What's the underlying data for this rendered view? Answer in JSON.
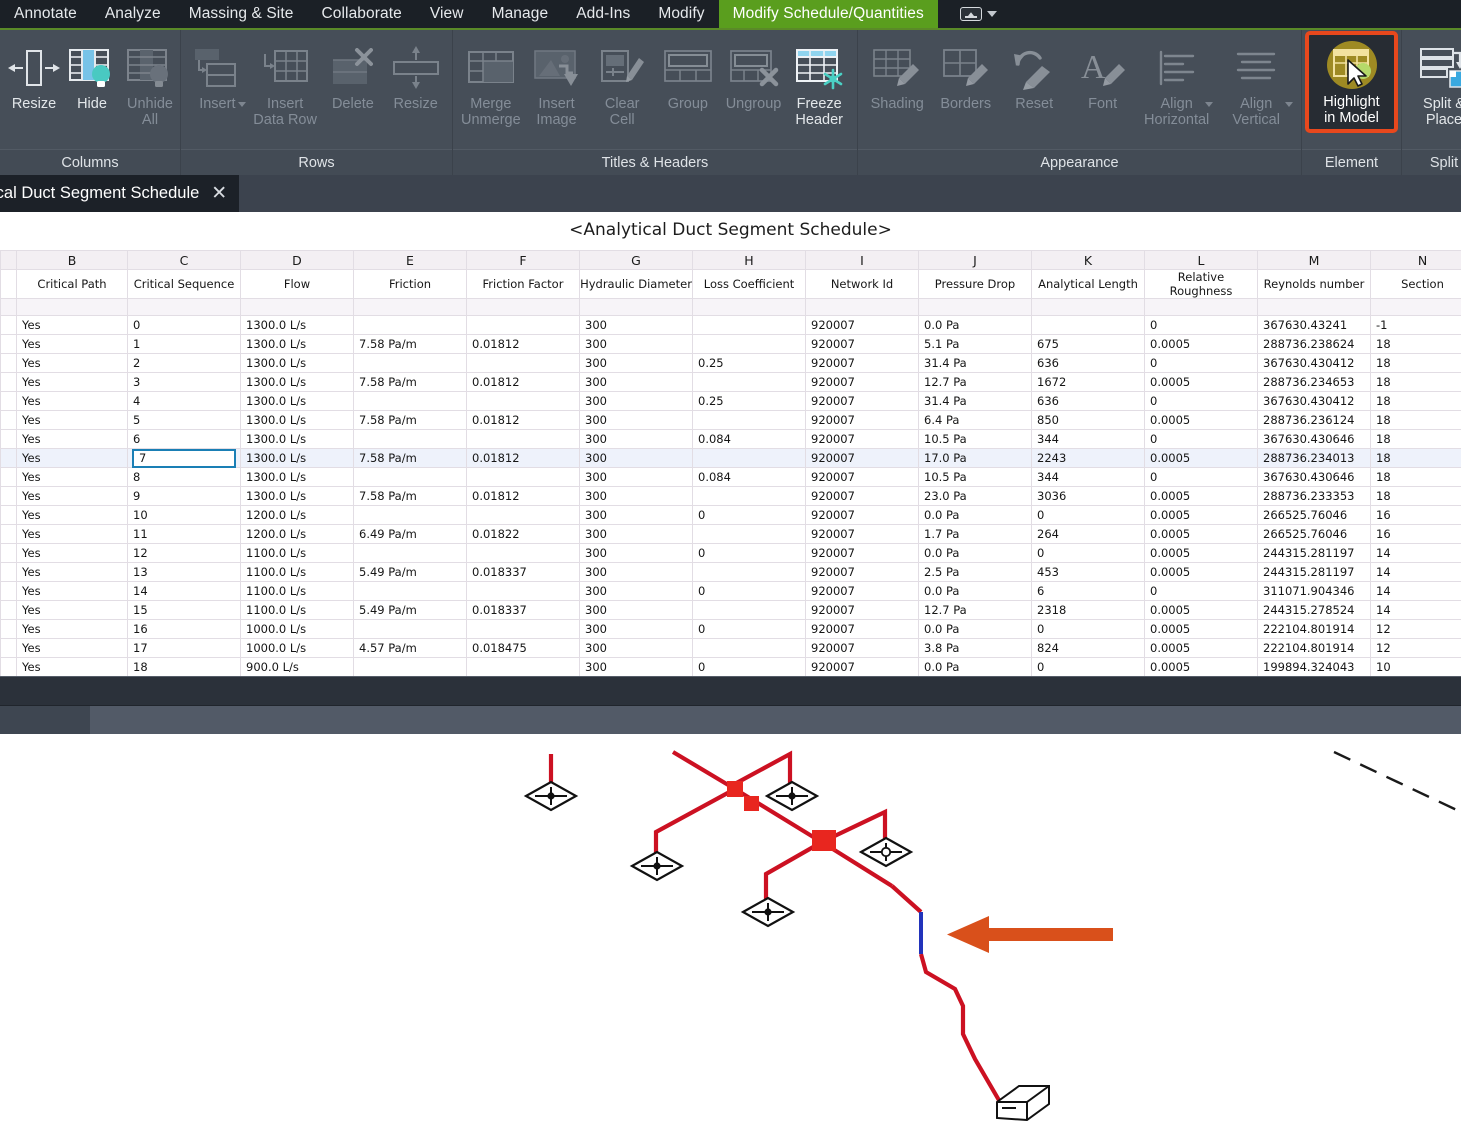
{
  "ribbon": {
    "tabs": [
      {
        "label": "Annotate",
        "active": false
      },
      {
        "label": "Analyze",
        "active": false
      },
      {
        "label": "Massing & Site",
        "active": false
      },
      {
        "label": "Collaborate",
        "active": false
      },
      {
        "label": "View",
        "active": false
      },
      {
        "label": "Manage",
        "active": false
      },
      {
        "label": "Add-Ins",
        "active": false
      },
      {
        "label": "Modify",
        "active": false
      },
      {
        "label": "Modify Schedule/Quantities",
        "active": true
      }
    ],
    "accent_green": "#5a9e1e",
    "highlight_orange": "#e8481d",
    "panels": [
      {
        "title": "Columns",
        "buttons": [
          {
            "label": "Resize",
            "icon": "column-resize-icon",
            "disabled": false,
            "dropdown": false
          },
          {
            "label": "Hide",
            "icon": "column-hide-icon",
            "disabled": false,
            "dropdown": false
          },
          {
            "label": "Unhide\nAll",
            "icon": "column-unhide-all-icon",
            "disabled": true,
            "dropdown": false
          }
        ]
      },
      {
        "title": "Rows",
        "buttons": [
          {
            "label": "Insert",
            "icon": "row-insert-icon",
            "disabled": true,
            "dropdown": true
          },
          {
            "label": "Insert\nData Row",
            "icon": "insert-data-row-icon",
            "disabled": true,
            "dropdown": false
          },
          {
            "label": "Delete",
            "icon": "row-delete-icon",
            "disabled": true,
            "dropdown": false
          },
          {
            "label": "Resize",
            "icon": "row-resize-icon",
            "disabled": true,
            "dropdown": false
          }
        ]
      },
      {
        "title": "Titles & Headers",
        "buttons": [
          {
            "label": "Merge\nUnmerge",
            "icon": "merge-unmerge-icon",
            "disabled": true,
            "dropdown": false
          },
          {
            "label": "Insert\nImage",
            "icon": "insert-image-icon",
            "disabled": true,
            "dropdown": false
          },
          {
            "label": "Clear\nCell",
            "icon": "clear-cell-icon",
            "disabled": true,
            "dropdown": false
          },
          {
            "label": "Group",
            "icon": "group-icon",
            "disabled": true,
            "dropdown": false
          },
          {
            "label": "Ungroup",
            "icon": "ungroup-icon",
            "disabled": true,
            "dropdown": false
          },
          {
            "label": "Freeze\nHeader",
            "icon": "freeze-header-icon",
            "disabled": false,
            "dropdown": false
          }
        ]
      },
      {
        "title": "Appearance",
        "buttons": [
          {
            "label": "Shading",
            "icon": "shading-icon",
            "disabled": true,
            "dropdown": false
          },
          {
            "label": "Borders",
            "icon": "borders-icon",
            "disabled": true,
            "dropdown": false
          },
          {
            "label": "Reset",
            "icon": "reset-icon",
            "disabled": true,
            "dropdown": false
          },
          {
            "label": "Font",
            "icon": "font-icon",
            "disabled": true,
            "dropdown": false
          },
          {
            "label": "Align\nHorizontal",
            "icon": "align-horizontal-icon",
            "disabled": true,
            "dropdown": true
          },
          {
            "label": "Align\nVertical",
            "icon": "align-vertical-icon",
            "disabled": true,
            "dropdown": true
          }
        ]
      },
      {
        "title": "Element",
        "buttons": [
          {
            "label": "Highlight\nin Model",
            "icon": "highlight-in-model-icon",
            "disabled": false,
            "dropdown": false,
            "highlighted": true
          }
        ]
      },
      {
        "title": "Split",
        "buttons": [
          {
            "label": "Split &\nPlace",
            "icon": "split-and-place-icon",
            "disabled": false,
            "dropdown": false
          }
        ]
      }
    ]
  },
  "schedule_tab": {
    "label": "ical Duct Segment Schedule",
    "close_icon": "close-icon"
  },
  "schedule": {
    "title": "<Analytical Duct Segment Schedule>",
    "column_letters": [
      "",
      "B",
      "C",
      "D",
      "E",
      "F",
      "G",
      "H",
      "I",
      "J",
      "K",
      "L",
      "M",
      "N"
    ],
    "column_names": [
      "",
      "Critical Path",
      "Critical Sequence",
      "Flow",
      "Friction",
      "Friction Factor",
      "Hydraulic Diameter",
      "Loss Coefficient",
      "Network Id",
      "Pressure Drop",
      "Analytical Length",
      "Relative Roughness",
      "Reynolds number",
      "Section"
    ],
    "selected_row_index": 7,
    "selected_column_index": 2,
    "rows": [
      [
        "",
        "Yes",
        "0",
        "1300.0 L/s",
        "",
        "",
        "300",
        "",
        "920007",
        "0.0 Pa",
        "",
        "0",
        "367630.43241",
        "-1"
      ],
      [
        "",
        "Yes",
        "1",
        "1300.0 L/s",
        "7.58 Pa/m",
        "0.01812",
        "300",
        "",
        "920007",
        "5.1 Pa",
        "675",
        "0.0005",
        "288736.238624",
        "18"
      ],
      [
        "",
        "Yes",
        "2",
        "1300.0 L/s",
        "",
        "",
        "300",
        "0.25",
        "920007",
        "31.4 Pa",
        "636",
        "0",
        "367630.430412",
        "18"
      ],
      [
        "",
        "Yes",
        "3",
        "1300.0 L/s",
        "7.58 Pa/m",
        "0.01812",
        "300",
        "",
        "920007",
        "12.7 Pa",
        "1672",
        "0.0005",
        "288736.234653",
        "18"
      ],
      [
        "",
        "Yes",
        "4",
        "1300.0 L/s",
        "",
        "",
        "300",
        "0.25",
        "920007",
        "31.4 Pa",
        "636",
        "0",
        "367630.430412",
        "18"
      ],
      [
        "",
        "Yes",
        "5",
        "1300.0 L/s",
        "7.58 Pa/m",
        "0.01812",
        "300",
        "",
        "920007",
        "6.4 Pa",
        "850",
        "0.0005",
        "288736.236124",
        "18"
      ],
      [
        "",
        "Yes",
        "6",
        "1300.0 L/s",
        "",
        "",
        "300",
        "0.084",
        "920007",
        "10.5 Pa",
        "344",
        "0",
        "367630.430646",
        "18"
      ],
      [
        "",
        "Yes",
        "7",
        "1300.0 L/s",
        "7.58 Pa/m",
        "0.01812",
        "300",
        "",
        "920007",
        "17.0 Pa",
        "2243",
        "0.0005",
        "288736.234013",
        "18"
      ],
      [
        "",
        "Yes",
        "8",
        "1300.0 L/s",
        "",
        "",
        "300",
        "0.084",
        "920007",
        "10.5 Pa",
        "344",
        "0",
        "367630.430646",
        "18"
      ],
      [
        "",
        "Yes",
        "9",
        "1300.0 L/s",
        "7.58 Pa/m",
        "0.01812",
        "300",
        "",
        "920007",
        "23.0 Pa",
        "3036",
        "0.0005",
        "288736.233353",
        "18"
      ],
      [
        "",
        "Yes",
        "10",
        "1200.0 L/s",
        "",
        "",
        "300",
        "0",
        "920007",
        "0.0 Pa",
        "0",
        "0.0005",
        "266525.76046",
        "16"
      ],
      [
        "",
        "Yes",
        "11",
        "1200.0 L/s",
        "6.49 Pa/m",
        "0.01822",
        "300",
        "",
        "920007",
        "1.7 Pa",
        "264",
        "0.0005",
        "266525.76046",
        "16"
      ],
      [
        "",
        "Yes",
        "12",
        "1100.0 L/s",
        "",
        "",
        "300",
        "0",
        "920007",
        "0.0 Pa",
        "0",
        "0.0005",
        "244315.281197",
        "14"
      ],
      [
        "",
        "Yes",
        "13",
        "1100.0 L/s",
        "5.49 Pa/m",
        "0.018337",
        "300",
        "",
        "920007",
        "2.5 Pa",
        "453",
        "0.0005",
        "244315.281197",
        "14"
      ],
      [
        "",
        "Yes",
        "14",
        "1100.0 L/s",
        "",
        "",
        "300",
        "0",
        "920007",
        "0.0 Pa",
        "6",
        "0",
        "311071.904346",
        "14"
      ],
      [
        "",
        "Yes",
        "15",
        "1100.0 L/s",
        "5.49 Pa/m",
        "0.018337",
        "300",
        "",
        "920007",
        "12.7 Pa",
        "2318",
        "0.0005",
        "244315.278524",
        "14"
      ],
      [
        "",
        "Yes",
        "16",
        "1000.0 L/s",
        "",
        "",
        "300",
        "0",
        "920007",
        "0.0 Pa",
        "0",
        "0.0005",
        "222104.801914",
        "12"
      ],
      [
        "",
        "Yes",
        "17",
        "1000.0 L/s",
        "4.57 Pa/m",
        "0.018475",
        "300",
        "",
        "920007",
        "3.8 Pa",
        "824",
        "0.0005",
        "222104.801914",
        "12"
      ],
      [
        "",
        "Yes",
        "18",
        "900.0 L/s",
        "",
        "",
        "300",
        "0",
        "920007",
        "0.0 Pa",
        "0",
        "0.0005",
        "199894.324043",
        "10"
      ]
    ]
  },
  "viewport": {
    "name": "duct-network-3d-view",
    "duct_color": "#cc1122",
    "highlighted_segment_color": "#2233bb",
    "annotation_arrow_color": "#d9501b",
    "background": "#ffffff",
    "elements": {
      "diffusers": 5,
      "fittings": 3,
      "air_terminal_unit": "equipment-box",
      "annotation_arrow": "highlight-pointer-arrow",
      "reference_plane": "dashed-reference-line"
    }
  }
}
